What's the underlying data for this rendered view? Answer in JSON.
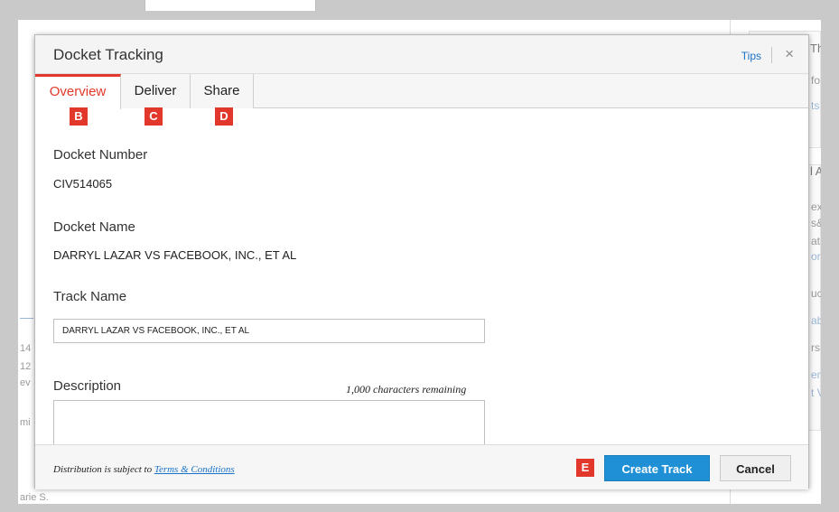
{
  "background": {
    "right_panel_fragments": [
      "Th",
      "fo",
      "ts",
      "l A",
      "ex",
      "s&",
      "at",
      "ore",
      "uc",
      "ab",
      "rs",
      "en",
      "t V"
    ],
    "left_fragments": [
      "14",
      "12",
      "ev",
      "mi",
      "arie S."
    ]
  },
  "modal": {
    "title": "Docket Tracking",
    "tips_label": "Tips",
    "close_icon": "×",
    "tabs": [
      {
        "label": "Overview",
        "callout": "B",
        "active": true
      },
      {
        "label": "Deliver",
        "callout": "C",
        "active": false
      },
      {
        "label": "Share",
        "callout": "D",
        "active": false
      }
    ],
    "fields": {
      "docket_number_label": "Docket Number",
      "docket_number_value": "CIV514065",
      "docket_name_label": "Docket Name",
      "docket_name_value": "DARRYL LAZAR VS FACEBOOK, INC., ET AL",
      "track_name_label": "Track Name",
      "track_name_value": "DARRYL LAZAR VS FACEBOOK, INC., ET AL",
      "description_label": "Description",
      "description_value": "",
      "characters_remaining": "1,000 characters remaining"
    },
    "footer": {
      "distribution_text": "Distribution is subject to",
      "terms_link": "Terms & Conditions",
      "callout": "E",
      "create_track_label": "Create Track",
      "cancel_label": "Cancel"
    }
  },
  "colors": {
    "accent_red": "#e2382b",
    "primary_blue": "#1f8fd6",
    "link_blue": "#1a73c9"
  }
}
